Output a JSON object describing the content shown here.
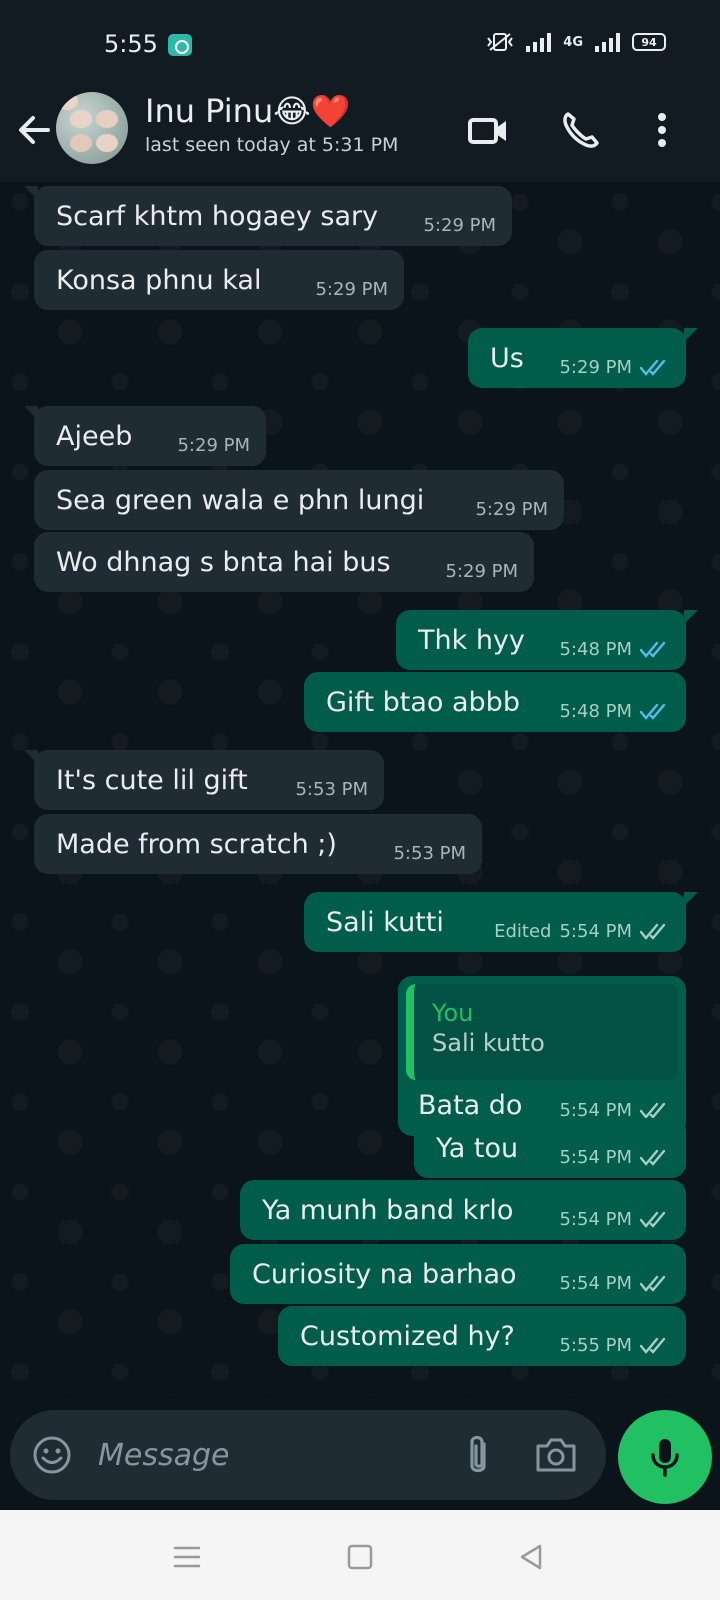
{
  "status_bar": {
    "time": "5:55",
    "network": "4G",
    "battery": "94"
  },
  "header": {
    "contact_name": "Inu Pinu😂❤️",
    "last_seen": "last seen today at 5:31 PM"
  },
  "messages": [
    {
      "direction": "in",
      "text": "Scarf khtm hogaey sary",
      "time": "5:29 PM"
    },
    {
      "direction": "in",
      "text": "Konsa phnu kal",
      "time": "5:29 PM"
    },
    {
      "direction": "out",
      "text": "Us",
      "time": "5:29 PM",
      "status": "read"
    },
    {
      "direction": "in",
      "text": "Ajeeb",
      "time": "5:29 PM"
    },
    {
      "direction": "in",
      "text": "Sea green wala e phn lungi",
      "time": "5:29 PM"
    },
    {
      "direction": "in",
      "text": "Wo dhnag s bnta hai bus",
      "time": "5:29 PM"
    },
    {
      "direction": "out",
      "text": "Thk hyy",
      "time": "5:48 PM",
      "status": "read"
    },
    {
      "direction": "out",
      "text": "Gift btao abbb",
      "time": "5:48 PM",
      "status": "read"
    },
    {
      "direction": "in",
      "text": "It's cute lil gift",
      "time": "5:53 PM"
    },
    {
      "direction": "in",
      "text": "Made from scratch ;)",
      "time": "5:53 PM"
    },
    {
      "direction": "out",
      "text": "Sali kutti",
      "time": "5:54 PM",
      "status": "delivered",
      "edited_label": "Edited"
    },
    {
      "direction": "out",
      "text": "Bata do",
      "time": "5:54 PM",
      "status": "delivered",
      "quote_author": "You",
      "quote_text": "Sali kutto"
    },
    {
      "direction": "out",
      "text": "Ya tou",
      "time": "5:54 PM",
      "status": "delivered"
    },
    {
      "direction": "out",
      "text": "Ya munh band krlo",
      "time": "5:54 PM",
      "status": "delivered"
    },
    {
      "direction": "out",
      "text": "Curiosity na barhao",
      "time": "5:54 PM",
      "status": "delivered"
    },
    {
      "direction": "out",
      "text": "Customized hy?",
      "time": "5:55 PM",
      "status": "delivered"
    }
  ],
  "composer": {
    "placeholder": "Message"
  },
  "colors": {
    "incoming_bubble": "#202c33",
    "outgoing_bubble": "#005c4b",
    "accent": "#21c063",
    "read_tick": "#53bdeb",
    "delivered_tick": "#a6cfc3"
  }
}
